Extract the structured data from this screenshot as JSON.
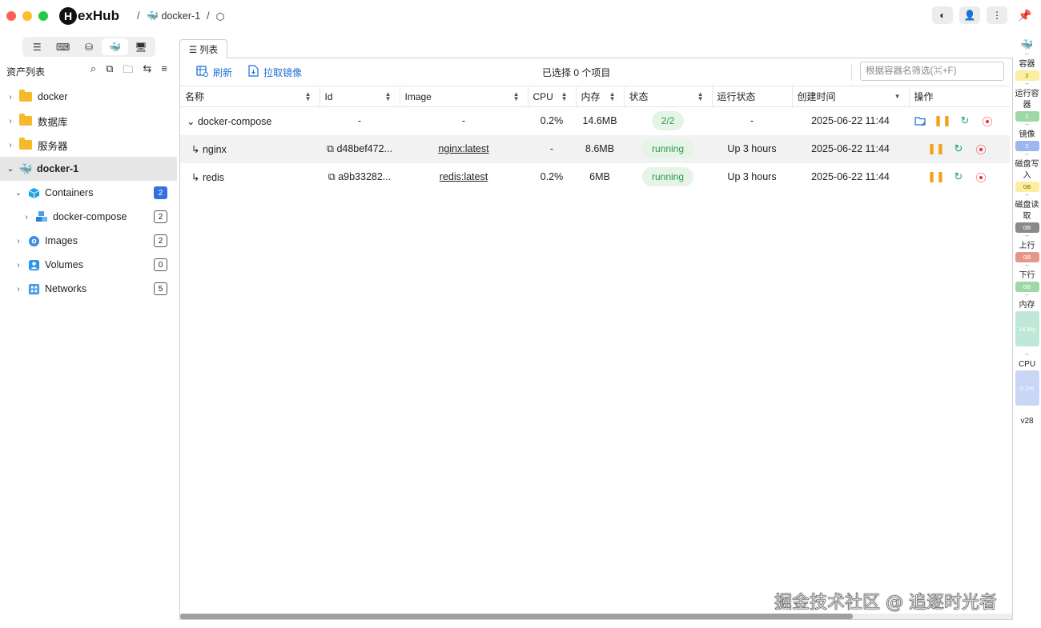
{
  "app": {
    "name": "HexHub",
    "logo_letter": "H",
    "logo_rest": "exHub"
  },
  "breadcrumb": {
    "item1": "docker-1",
    "sep": "/"
  },
  "sidebar": {
    "title": "资产列表",
    "tree": [
      {
        "label": "docker"
      },
      {
        "label": "数据库"
      },
      {
        "label": "服务器"
      },
      {
        "label": "docker-1"
      },
      {
        "label": "Containers",
        "count": "2"
      },
      {
        "label": "docker-compose",
        "count": "2"
      },
      {
        "label": "Images",
        "count": "2"
      },
      {
        "label": "Volumes",
        "count": "0"
      },
      {
        "label": "Networks",
        "count": "5"
      }
    ]
  },
  "main": {
    "tab_label": "列表",
    "refresh_label": "刷新",
    "pull_label": "拉取镜像",
    "selection_info": "已选择 0 个项目",
    "filter_placeholder": "根据容器名筛选(⌘+F)",
    "columns": [
      "名称",
      "Id",
      "Image",
      "CPU",
      "内存",
      "状态",
      "运行状态",
      "创建时间",
      "操作"
    ],
    "rows": [
      {
        "name": "docker-compose",
        "id": "-",
        "image": "-",
        "cpu": "0.2%",
        "mem": "14.6MB",
        "status": "2/2",
        "run": "-",
        "created": "2025-06-22 11:44"
      },
      {
        "name": "nginx",
        "id": "d48bef472...",
        "image": "nginx:latest",
        "cpu": "-",
        "mem": "8.6MB",
        "status": "running",
        "run": "Up 3 hours",
        "created": "2025-06-22 11:44"
      },
      {
        "name": "redis",
        "id": "a9b33282...",
        "image": "redis:latest",
        "cpu": "0.2%",
        "mem": "6MB",
        "status": "running",
        "run": "Up 3 hours",
        "created": "2025-06-22 11:44"
      }
    ]
  },
  "stats": {
    "containers_label": "容器",
    "containers_val": "2",
    "running_label": "运行容器",
    "running_val": "2",
    "images_label": "镜像",
    "images_val": "2",
    "disk_write_label": "磁盘写入",
    "disk_write_val": "0B",
    "disk_read_label": "磁盘读取",
    "disk_read_val": "0B",
    "up_label": "上行",
    "up_val": "0B",
    "down_label": "下行",
    "down_val": "0B",
    "mem_label": "内存",
    "mem_val": "14.6M",
    "cpu_label": "CPU",
    "cpu_val": "0.2%",
    "version": "v28",
    "dash": "–"
  },
  "watermark": "掘金技术社区 @ 追逐时光者",
  "colors": {
    "accent": "#1d6fd6",
    "running_bg": "#e5f4e6",
    "running_fg": "#2e9a4b",
    "folder": "#f6b92b",
    "badge_blue": "#3670e0"
  }
}
